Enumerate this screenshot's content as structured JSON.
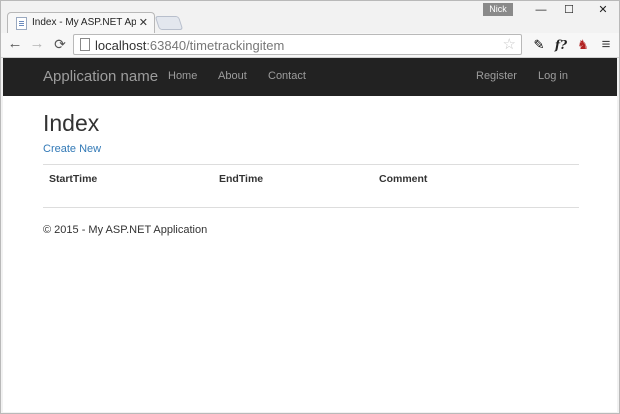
{
  "browser": {
    "tab_title": "Index - My ASP.NET Appli",
    "tab_close": "✕",
    "profile_name": "Nick",
    "window_controls": {
      "minimize": "—",
      "maximize": "☐",
      "close": "✕"
    },
    "nav": {
      "back": "←",
      "forward": "→",
      "reload": "⟳"
    },
    "url_host": "localhost",
    "url_path": ":63840/timetrackingitem",
    "star_icon": "☆",
    "extensions": {
      "pen": "✎",
      "formula": "f?",
      "chair": "♞",
      "menu": "≡"
    }
  },
  "navbar": {
    "brand": "Application name",
    "links": {
      "home": "Home",
      "about": "About",
      "contact": "Contact"
    },
    "right": {
      "register": "Register",
      "login": "Log in"
    },
    "background": "#222222",
    "link_color": "#9d9d9d"
  },
  "main": {
    "title": "Index",
    "create_link": "Create New",
    "link_color": "#337ab7",
    "table": {
      "columns": [
        "StartTime",
        "EndTime",
        "Comment"
      ],
      "rows": []
    }
  },
  "footer": {
    "text": "© 2015 - My ASP.NET Application"
  }
}
